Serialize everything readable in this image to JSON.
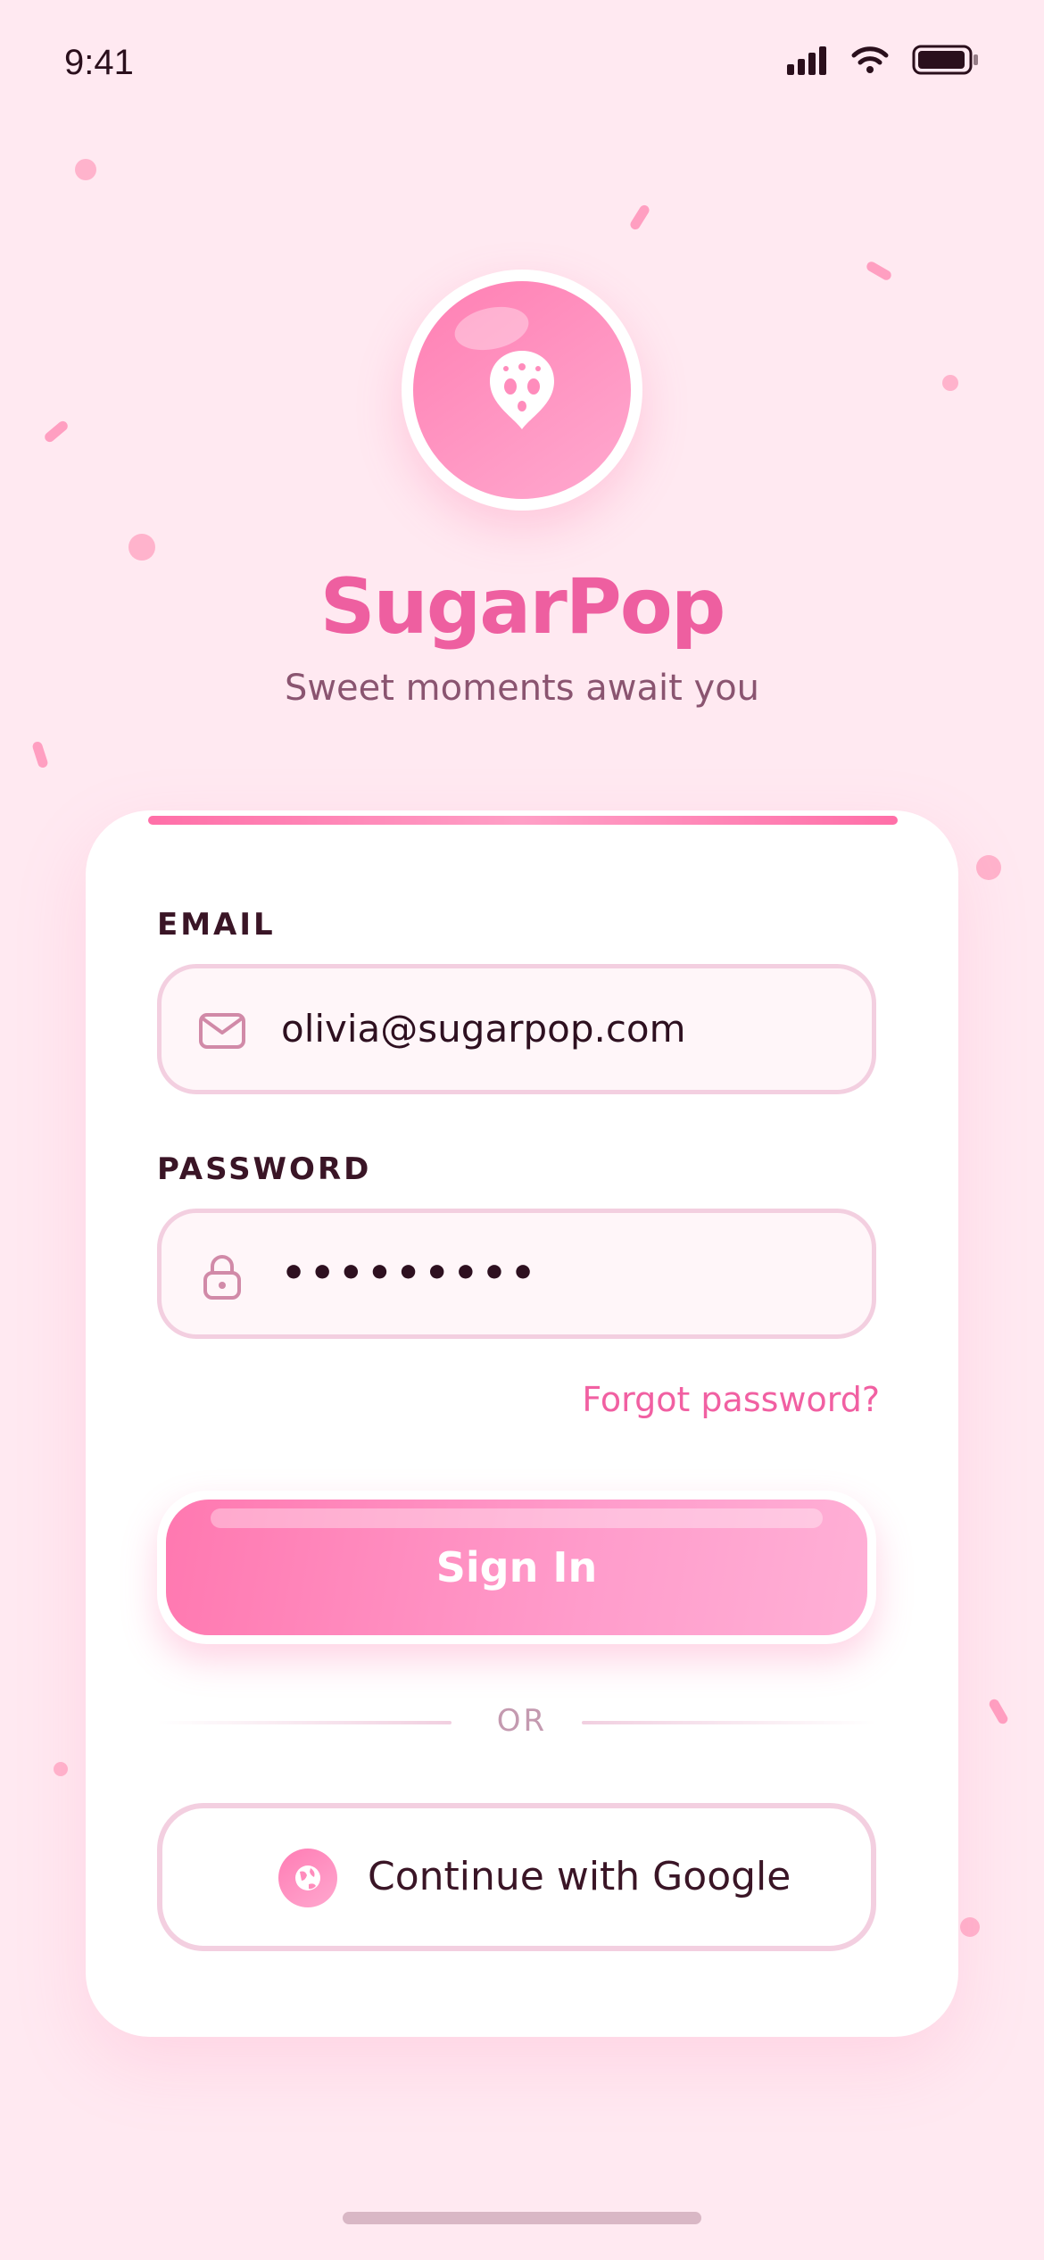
{
  "status_bar": {
    "time": "9:41"
  },
  "brand": {
    "name": "SugarPop",
    "tagline": "Sweet moments await you",
    "primary_color": "#ee5fa0",
    "background_color": "#ffe9f1"
  },
  "form": {
    "email_label": "EMAIL",
    "email_value": "olivia@sugarpop.com",
    "password_label": "PASSWORD",
    "password_value": "•••••••••",
    "forgot_label": "Forgot password?",
    "signin_label": "Sign In",
    "divider_label": "OR",
    "google_label": "Continue with Google"
  },
  "icons": {
    "status": [
      "signal-icon",
      "wifi-icon",
      "battery-icon"
    ],
    "logo": "heart-sprinkle-icon",
    "email": "mail-icon",
    "password": "lock-icon",
    "google": "globe-icon"
  }
}
